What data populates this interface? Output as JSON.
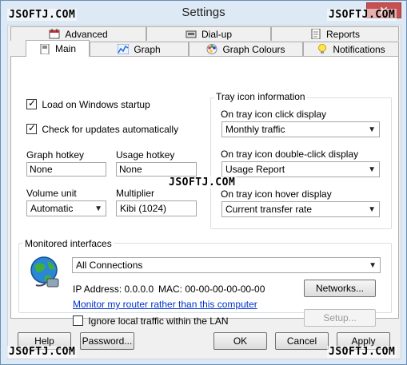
{
  "window": {
    "title": "Settings",
    "close_symbol": "✕"
  },
  "watermarks": [
    "JSOFTJ.COM",
    "JSOFTJ.COM",
    "JSOFTJ.COM",
    "JSOFTJ.COM",
    "JSOFTJ.COM"
  ],
  "tabs_row1": [
    {
      "label": "Advanced",
      "icon": "calendar-icon"
    },
    {
      "label": "Dial-up",
      "icon": "modem-icon"
    },
    {
      "label": "Reports",
      "icon": "report-icon"
    }
  ],
  "tabs_row2": [
    {
      "label": "Main",
      "icon": "main-icon",
      "active": true
    },
    {
      "label": "Graph",
      "icon": "graph-icon"
    },
    {
      "label": "Graph Colours",
      "icon": "palette-icon"
    },
    {
      "label": "Notifications",
      "icon": "bulb-icon"
    }
  ],
  "main": {
    "load_startup": {
      "label": "Load on Windows startup",
      "checked": true
    },
    "check_updates": {
      "label": "Check for updates automatically",
      "checked": true
    },
    "graph_hotkey": {
      "label": "Graph hotkey",
      "value": "None"
    },
    "usage_hotkey": {
      "label": "Usage hotkey",
      "value": "None"
    },
    "volume_unit": {
      "label": "Volume unit",
      "value": "Automatic"
    },
    "multiplier": {
      "label": "Multiplier",
      "value": "Kibi (1024)"
    }
  },
  "tray": {
    "group_label": "Tray icon information",
    "click_label": "On tray icon click display",
    "click_value": "Monthly traffic",
    "dblclick_label": "On tray icon double-click display",
    "dblclick_value": "Usage Report",
    "hover_label": "On tray icon hover display",
    "hover_value": "Current transfer rate"
  },
  "monitored": {
    "group_label": "Monitored interfaces",
    "connection_value": "All Connections",
    "ip_label": "IP Address: 0.0.0.0",
    "mac_label": "MAC: 00-00-00-00-00-00",
    "router_link": "Monitor my router rather than this computer",
    "ignore_lan": {
      "label": "Ignore local traffic within the LAN",
      "checked": false
    },
    "networks_button": "Networks...",
    "setup_button": "Setup..."
  },
  "footer": {
    "help": "Help",
    "password": "Password...",
    "ok": "OK",
    "cancel": "Cancel",
    "apply": "Apply"
  },
  "colors": {
    "accent_link": "#0033cc",
    "close_red": "#c75050"
  }
}
